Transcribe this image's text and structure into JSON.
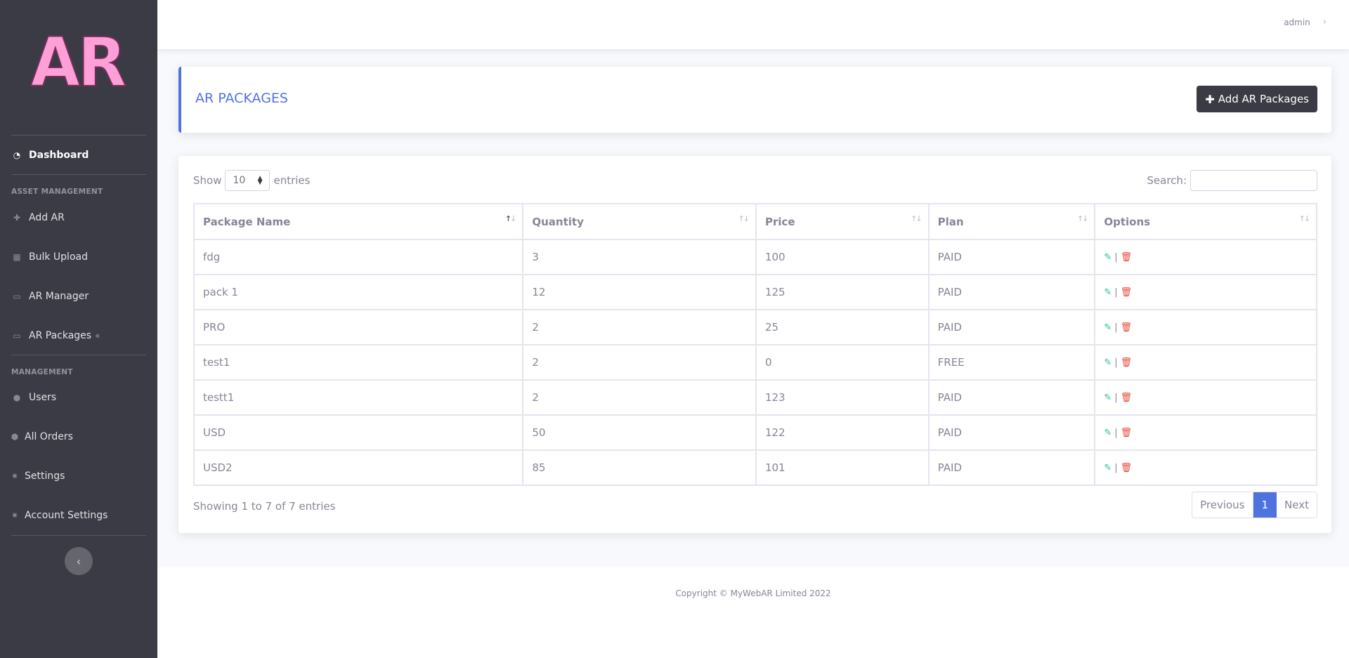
{
  "brand": {
    "logo_text": "AR"
  },
  "sidebar": {
    "dashboard": "Dashboard",
    "heading_asset": "ASSET MANAGEMENT",
    "add_ar": "Add AR",
    "bulk_upload": "Bulk Upload",
    "ar_manager": "AR Manager",
    "ar_packages": "AR Packages",
    "heading_management": "MANAGEMENT",
    "users": "Users",
    "all_orders": "All Orders",
    "settings": "Settings",
    "account_settings": "Account Settings"
  },
  "topbar": {
    "user": "admin"
  },
  "header": {
    "title": "AR PACKAGES",
    "add_button": "Add AR Packages"
  },
  "table_controls": {
    "show_label": "Show",
    "entries_value": "10",
    "entries_label": "entries",
    "search_label": "Search:",
    "search_value": ""
  },
  "table": {
    "columns": [
      "Package Name",
      "Quantity",
      "Price",
      "Plan",
      "Options"
    ],
    "rows": [
      [
        "fdg",
        "3",
        "100",
        "PAID"
      ],
      [
        "pack 1",
        "12",
        "125",
        "PAID"
      ],
      [
        "PRO",
        "2",
        "25",
        "PAID"
      ],
      [
        "test1",
        "2",
        "0",
        "FREE"
      ],
      [
        "testt1",
        "2",
        "123",
        "PAID"
      ],
      [
        "USD",
        "50",
        "122",
        "PAID"
      ],
      [
        "USD2",
        "85",
        "101",
        "PAID"
      ]
    ]
  },
  "pagination": {
    "info": "Showing 1 to 7 of 7 entries",
    "previous": "Previous",
    "current": "1",
    "next": "Next"
  },
  "footer": {
    "copyright": "Copyright © MyWebAR Limited 2022"
  },
  "colors": {
    "primary": "#4e73df",
    "sidebar": "#3a3b45",
    "edit": "#1cc88a",
    "delete": "#e74a3b"
  }
}
